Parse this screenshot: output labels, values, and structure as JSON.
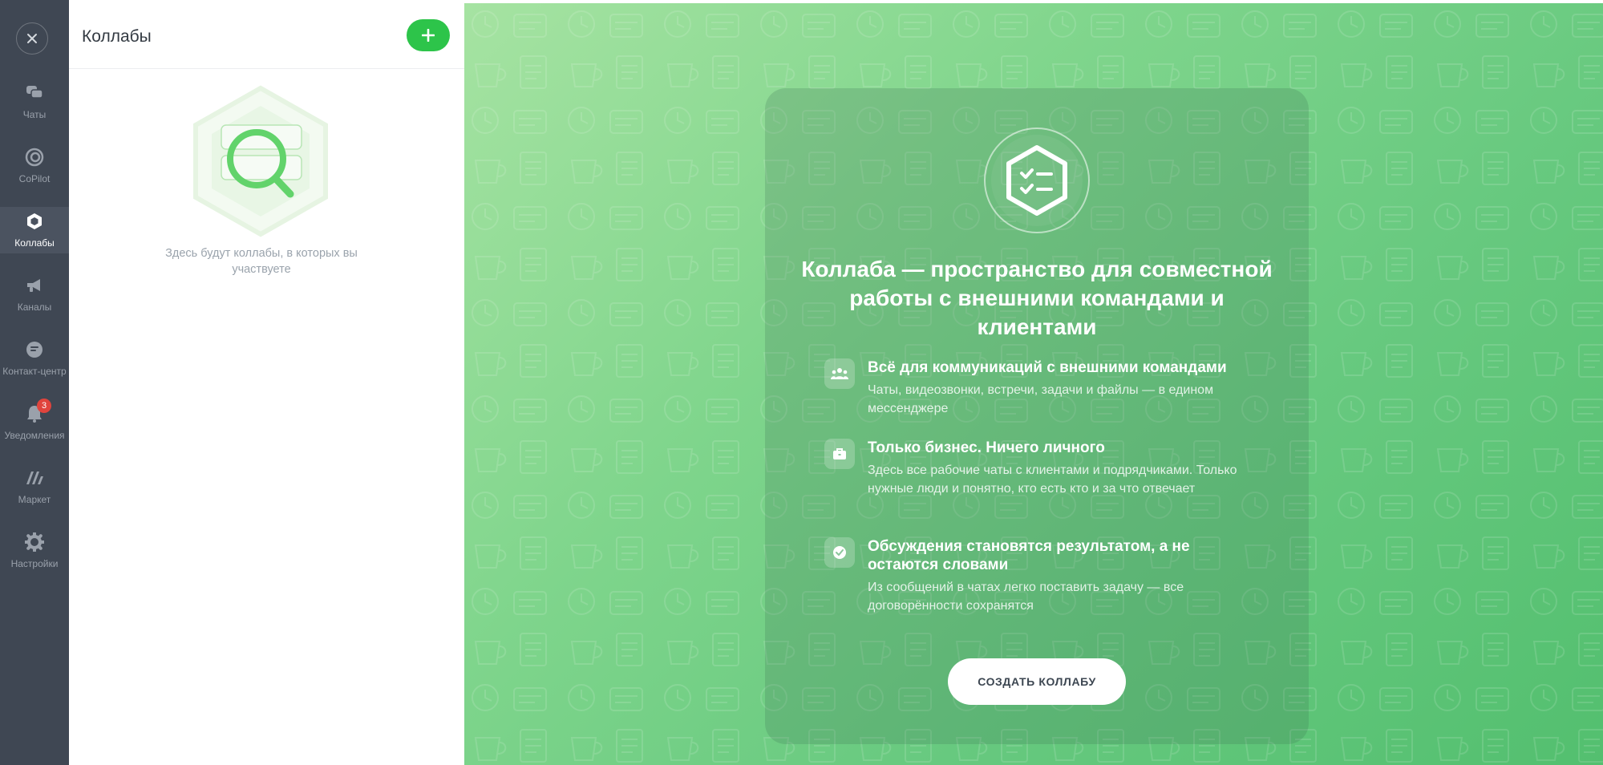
{
  "rail": {
    "items": [
      {
        "label": "Чаты",
        "icon": "chats-icon",
        "active": false
      },
      {
        "label": "CoPilot",
        "icon": "copilot-icon",
        "active": false
      },
      {
        "label": "Коллабы",
        "icon": "collabs-icon",
        "active": true
      },
      {
        "label": "Каналы",
        "icon": "megaphone-icon",
        "active": false
      },
      {
        "label": "Контакт-центр",
        "icon": "contact-center-icon",
        "active": false
      },
      {
        "label": "Уведомления",
        "icon": "bell-icon",
        "active": false,
        "badge": "3"
      },
      {
        "label": "Маркет",
        "icon": "market-icon",
        "active": false
      },
      {
        "label": "Настройки",
        "icon": "gear-icon",
        "active": false
      }
    ]
  },
  "panel": {
    "title": "Коллабы",
    "empty_text": "Здесь будут коллабы, в которых вы участвуете"
  },
  "promo": {
    "title": "Коллаба — пространство для совместной работы с внешними командами и клиентами",
    "features": [
      {
        "title": "Всё для коммуникаций с внешними командами",
        "desc": "Чаты, видеозвонки, встречи, задачи и файлы — в едином мессенджере",
        "icon": "people-icon"
      },
      {
        "title": "Только бизнес. Ничего личного",
        "desc": "Здесь все рабочие чаты с клиентами и подрядчиками. Только нужные люди и понятно, кто есть кто и за что отвечает",
        "icon": "briefcase-icon"
      },
      {
        "title": "Обсуждения становятся результатом, а не остаются словами",
        "desc": "Из сообщений в чатах легко поставить задачу — все договорённости сохранятся",
        "icon": "check-circle-icon"
      }
    ],
    "button_label": "СОЗДАТЬ КОЛЛАБУ"
  },
  "colors": {
    "rail_bg": "#3f4753",
    "accent_green": "#2dc44a",
    "badge_red": "#e0443d"
  }
}
